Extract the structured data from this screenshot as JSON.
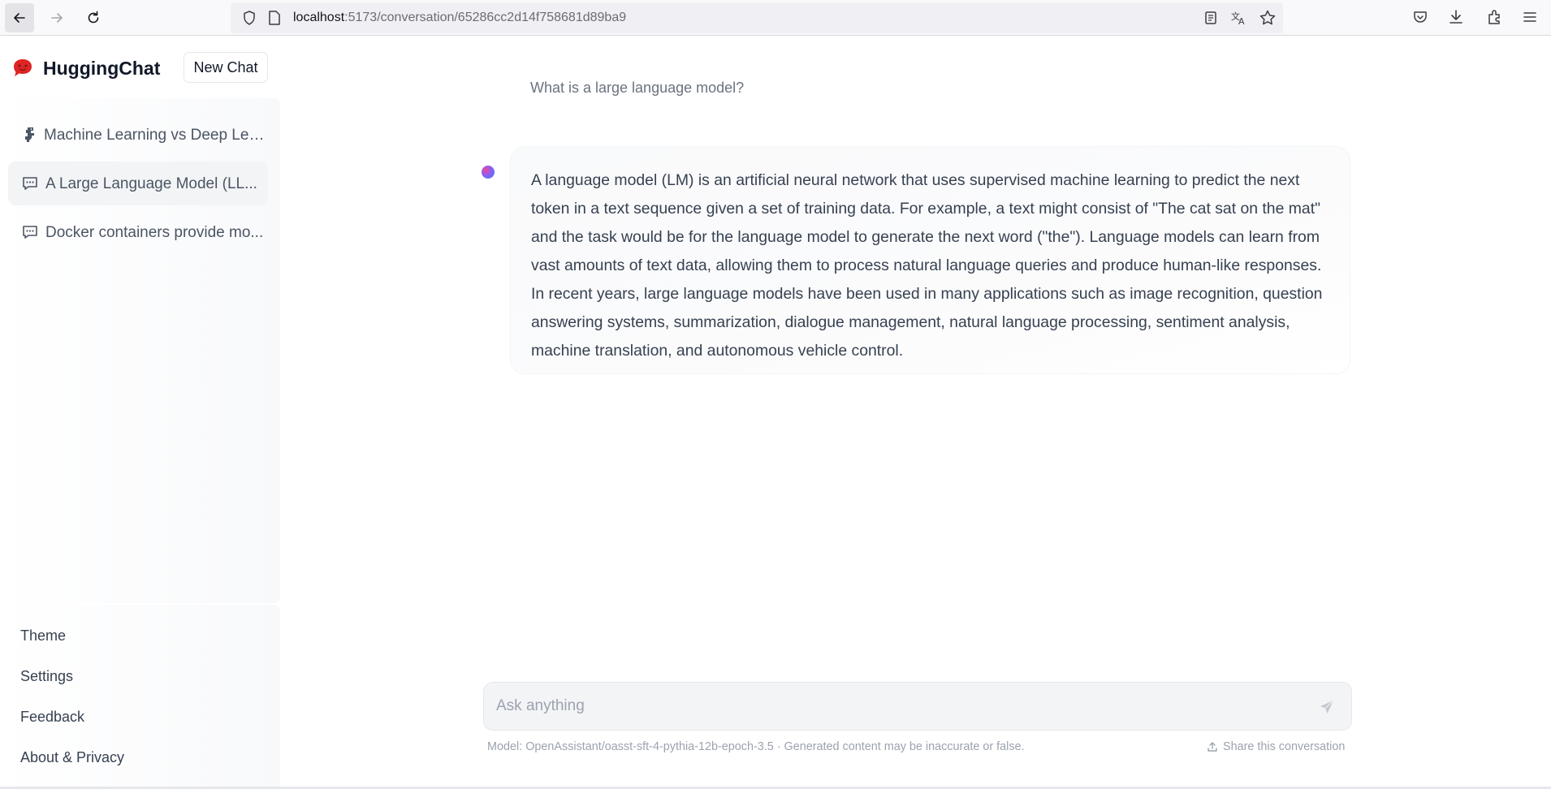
{
  "browser": {
    "url_host": "localhost",
    "url_path": ":5173/conversation/65286cc2d14f758681d89ba9"
  },
  "sidebar": {
    "brand": "HuggingChat",
    "new_chat_label": "New Chat",
    "conversations": [
      {
        "label": "Machine Learning vs Deep Lea...",
        "icon": "dino-emoji-icon",
        "active": false
      },
      {
        "label": "A Large Language Model (LL...",
        "icon": "chat-bubble-icon",
        "active": true
      },
      {
        "label": "Docker containers provide mo...",
        "icon": "chat-bubble-icon",
        "active": false
      }
    ],
    "menu": {
      "theme": "Theme",
      "settings": "Settings",
      "feedback": "Feedback",
      "about": "About & Privacy"
    }
  },
  "chat": {
    "user_message": "What is a large language model?",
    "assistant_message": "A language model (LM) is an artificial neural network that uses supervised machine learning to predict the next token in a text sequence given a set of training data. For example, a text might consist of \"The cat sat on the mat\" and the task would be for the language model to generate the next word (\"the\"). Language models can learn from vast amounts of text data, allowing them to process natural language queries and produce human-like responses. In recent years, large language models have been used in many applications such as image recognition, question answering systems, summarization, dialogue management, natural language processing, sentiment analysis, machine translation, and autonomous vehicle control.",
    "input_placeholder": "Ask anything",
    "model_info": "Model: OpenAssistant/oasst-sft-4-pythia-12b-epoch-3.5 · Generated content may be inaccurate or false.",
    "share_label": "Share this conversation"
  },
  "colors": {
    "brand_red": "#e02424",
    "avatar_gradient": [
      "#ec4899",
      "#8b5cf6",
      "#3b82f6"
    ]
  }
}
